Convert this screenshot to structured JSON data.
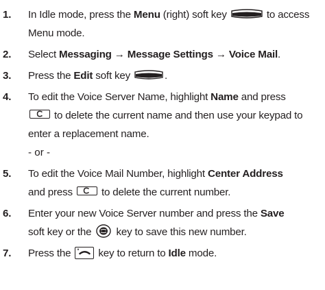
{
  "steps": [
    {
      "num": "1.",
      "t1": "In Idle mode, press the ",
      "b1": "Menu",
      "t2": " (right) soft key ",
      "icon": "right-soft-key-icon",
      "t3": " to access Menu mode."
    },
    {
      "num": "2.",
      "t1": "Select ",
      "b1": "Messaging → Message Settings → Voice Mail",
      "t2": "."
    },
    {
      "num": "3.",
      "t1": "Press the ",
      "b1": "Edit",
      "t2": " soft key ",
      "icon": "left-soft-key-icon",
      "t3": "."
    },
    {
      "num": "4.",
      "t1": "To edit the Voice Server Name, highlight ",
      "b1": "Name",
      "t2": " and press ",
      "icon": "clear-key-icon",
      "t3": " to delete the current name and then use your keypad to enter a replacement name."
    },
    {
      "num": "5.",
      "t1": "To edit the Voice Mail Number, highlight ",
      "b1": "Center Address",
      "t2": " and press ",
      "icon": "clear-key-icon",
      "t3": " to delete the current number."
    },
    {
      "num": "6.",
      "t1": "Enter your new Voice Server number and press the ",
      "b1": "Save",
      "t2": " soft key or the ",
      "icon": "ok-key-icon",
      "t3": " key to save this new number."
    },
    {
      "num": "7.",
      "t1": "Press the ",
      "icon": "end-key-icon",
      "t2": " key to return to ",
      "b1": "Idle",
      "t3": " mode."
    }
  ],
  "or_text": "- or -"
}
